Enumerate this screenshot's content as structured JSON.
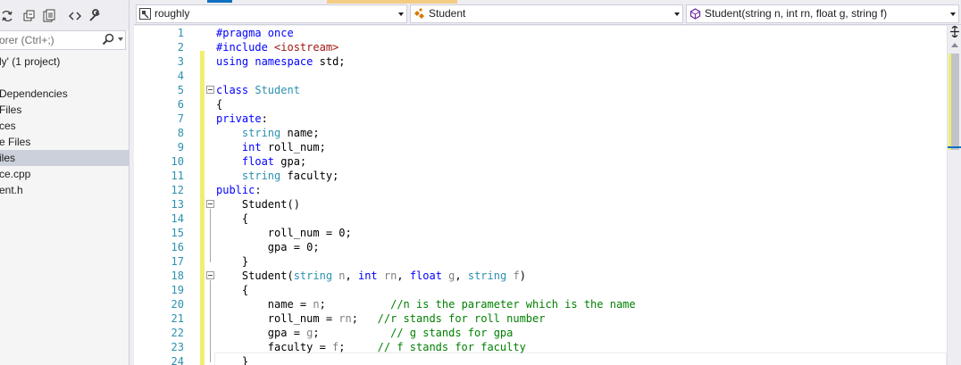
{
  "solution_explorer": {
    "search_placeholder": "orer (Ctrl+;)",
    "tree": [
      {
        "label": "ly' (1 project)",
        "selected": false
      },
      {
        "label": "Dependencies",
        "selected": false
      },
      {
        "label": "Files",
        "selected": false
      },
      {
        "label": "ces",
        "selected": false
      },
      {
        "label": "e Files",
        "selected": false
      },
      {
        "label": "iles",
        "selected": true
      },
      {
        "label": "ce.cpp",
        "selected": false
      },
      {
        "label": "ent.h",
        "selected": false
      }
    ]
  },
  "navigation_bar": {
    "project": "roughly",
    "class": "Student",
    "member": "Student(string n, int rn, float g, string f)"
  },
  "editor": {
    "line_numbers": [
      "1",
      "2",
      "3",
      "4",
      "5",
      "6",
      "7",
      "8",
      "9",
      "10",
      "11",
      "12",
      "13",
      "14",
      "15",
      "16",
      "17",
      "18",
      "19",
      "20",
      "21",
      "22",
      "23",
      "24"
    ],
    "lines": [
      [
        {
          "t": "#pragma once",
          "c": "kw"
        }
      ],
      [
        {
          "t": "#include ",
          "c": "kw"
        },
        {
          "t": "<iostream>",
          "c": "str"
        }
      ],
      [
        {
          "t": "using",
          "c": "kw"
        },
        {
          "t": " "
        },
        {
          "t": "namespace",
          "c": "kw"
        },
        {
          "t": " std;"
        }
      ],
      [],
      [
        {
          "t": "class",
          "c": "kw"
        },
        {
          "t": " "
        },
        {
          "t": "Student",
          "c": "ty"
        }
      ],
      [
        {
          "t": "{"
        }
      ],
      [
        {
          "t": "private",
          "c": "kw"
        },
        {
          "t": ":"
        }
      ],
      [
        {
          "t": "    "
        },
        {
          "t": "string",
          "c": "ty"
        },
        {
          "t": " name;"
        }
      ],
      [
        {
          "t": "    "
        },
        {
          "t": "int",
          "c": "kw"
        },
        {
          "t": " roll_num;"
        }
      ],
      [
        {
          "t": "    "
        },
        {
          "t": "float",
          "c": "kw"
        },
        {
          "t": " gpa;"
        }
      ],
      [
        {
          "t": "    "
        },
        {
          "t": "string",
          "c": "ty"
        },
        {
          "t": " faculty;"
        }
      ],
      [
        {
          "t": "public",
          "c": "kw"
        },
        {
          "t": ":"
        }
      ],
      [
        {
          "t": "    Student()"
        }
      ],
      [
        {
          "t": "    {"
        }
      ],
      [
        {
          "t": "        roll_num = 0;"
        }
      ],
      [
        {
          "t": "        gpa = 0;"
        }
      ],
      [
        {
          "t": "    }"
        }
      ],
      [
        {
          "t": "    Student("
        },
        {
          "t": "string",
          "c": "ty"
        },
        {
          "t": " "
        },
        {
          "t": "n",
          "c": "pr"
        },
        {
          "t": ", "
        },
        {
          "t": "int",
          "c": "kw"
        },
        {
          "t": " "
        },
        {
          "t": "rn",
          "c": "pr"
        },
        {
          "t": ", "
        },
        {
          "t": "float",
          "c": "kw"
        },
        {
          "t": " "
        },
        {
          "t": "g",
          "c": "pr"
        },
        {
          "t": ", "
        },
        {
          "t": "string",
          "c": "ty"
        },
        {
          "t": " "
        },
        {
          "t": "f",
          "c": "pr"
        },
        {
          "t": ")"
        }
      ],
      [
        {
          "t": "    {"
        }
      ],
      [
        {
          "t": "        name = "
        },
        {
          "t": "n",
          "c": "pr"
        },
        {
          "t": ";          "
        },
        {
          "t": "//n is the parameter which is the name",
          "c": "cm"
        }
      ],
      [
        {
          "t": "        roll_num = "
        },
        {
          "t": "rn",
          "c": "pr"
        },
        {
          "t": ";   "
        },
        {
          "t": "//r stands for roll number",
          "c": "cm"
        }
      ],
      [
        {
          "t": "        gpa = "
        },
        {
          "t": "g",
          "c": "pr"
        },
        {
          "t": ";           "
        },
        {
          "t": "// g stands for gpa",
          "c": "cm"
        }
      ],
      [
        {
          "t": "        faculty = "
        },
        {
          "t": "f",
          "c": "pr"
        },
        {
          "t": ";     "
        },
        {
          "t": "// f stands for faculty",
          "c": "cm"
        }
      ],
      [
        {
          "t": "    }"
        }
      ]
    ],
    "outline_markers": [
      5,
      13,
      18
    ]
  },
  "colors": {
    "keyword": "#0000ff",
    "type": "#2b91af",
    "string": "#a31515",
    "comment": "#008000",
    "parameter": "#808080",
    "line_number": "#2b91af",
    "change_margin": "#efef6f",
    "selection": "#ccd0da"
  }
}
